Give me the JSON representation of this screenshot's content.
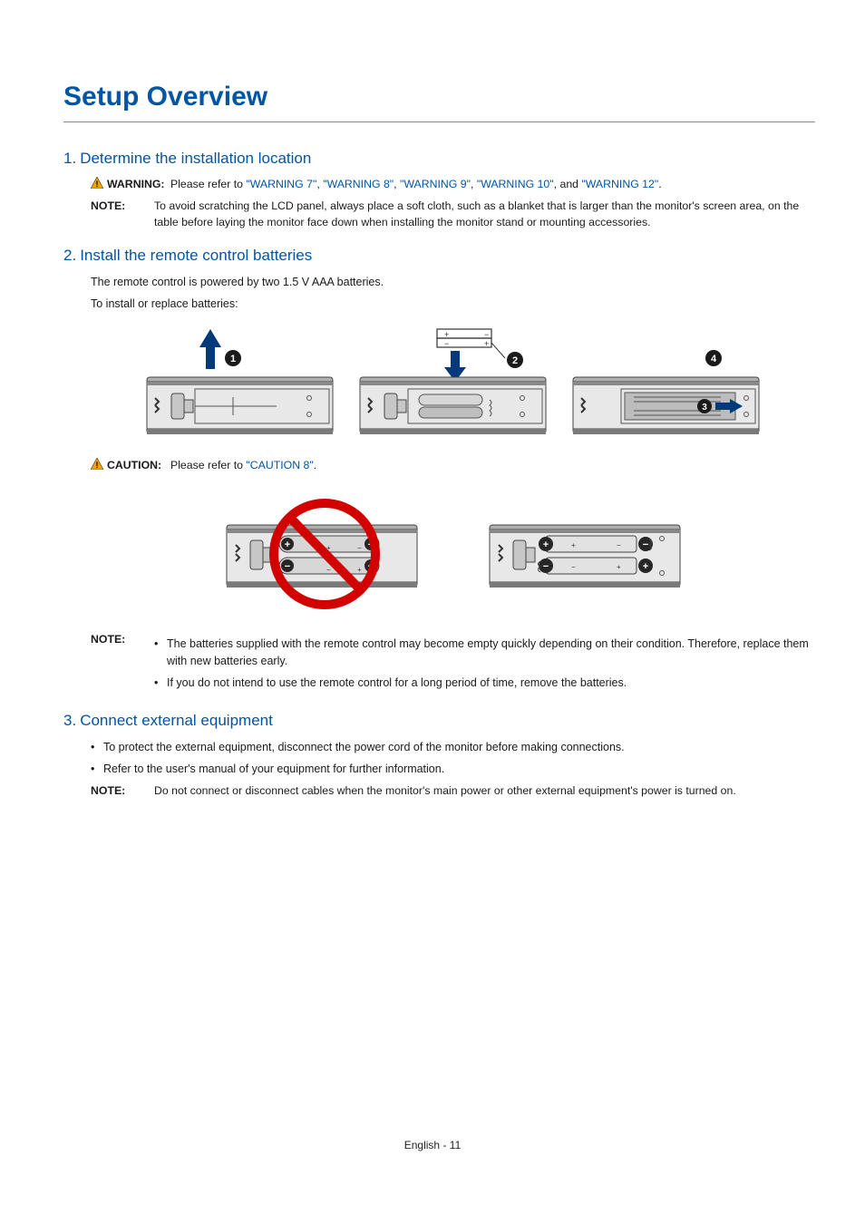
{
  "title": "Setup Overview",
  "sections": {
    "s1": {
      "num": "1.",
      "heading": "Determine the installation location"
    },
    "s2": {
      "num": "2.",
      "heading": "Install the remote control batteries"
    },
    "s3": {
      "num": "3.",
      "heading": "Connect external equipment"
    }
  },
  "s1_warning": {
    "label": "WARNING:",
    "pre": "Please refer to ",
    "links": {
      "w7": "\"WARNING 7\"",
      "w8": "\"WARNING 8\"",
      "w9": "\"WARNING 9\"",
      "w10": "\"WARNING 10\"",
      "w12": "\"WARNING 12\""
    },
    "sep": ", ",
    "and": ", and ",
    "post": "."
  },
  "s1_note": {
    "label": "NOTE:",
    "text": "To avoid scratching the LCD panel, always place a soft cloth, such as a blanket that is larger than the monitor's screen area, on the table before laying the monitor face down when installing the monitor stand or mounting accessories."
  },
  "s2_intro": {
    "l1": "The remote control is powered by two 1.5 V AAA batteries.",
    "l2": "To install or replace batteries:"
  },
  "s2_caution": {
    "label": "CAUTION:",
    "pre": "Please refer to ",
    "link": "\"CAUTION 8\"",
    "post": "."
  },
  "s2_note": {
    "label": "NOTE:",
    "b1": "The batteries supplied with the remote control may become empty quickly depending on their condition. Therefore, replace them with new batteries early.",
    "b2": "If you do not intend to use the remote control for a long period of time, remove the batteries."
  },
  "s3_bullets": {
    "b1": "To protect the external equipment, disconnect the power cord of the monitor before making connections.",
    "b2": "Refer to the user's manual of your equipment for further information."
  },
  "s3_note": {
    "label": "NOTE:",
    "text": "Do not connect or disconnect cables when the monitor's main power or other external equipment's power is turned on."
  },
  "bullet": "•",
  "footer": {
    "lang": "English",
    "sep": " - ",
    "page": "11"
  }
}
